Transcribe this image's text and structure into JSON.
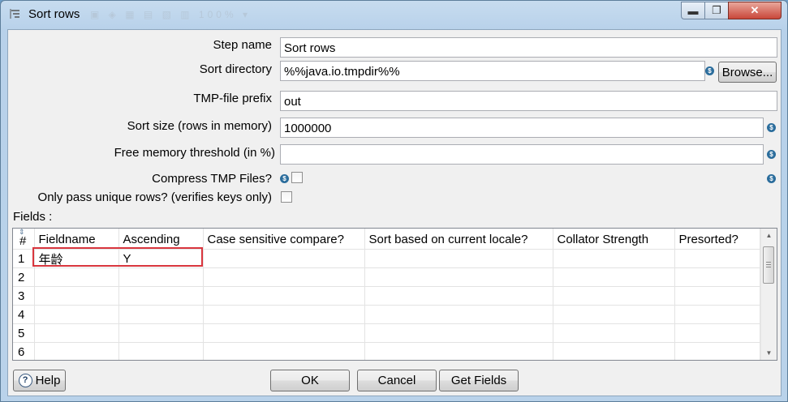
{
  "window": {
    "title": "Sort rows",
    "ghost_toolbar": "▣ ◈ ▦ ▤ ▧ ▥  100%  ▾",
    "controls": {
      "minimize": "▬",
      "maximize": "❐",
      "close": "✕"
    }
  },
  "form": {
    "step_name": {
      "label": "Step name",
      "value": "Sort rows"
    },
    "sort_directory": {
      "label": "Sort directory",
      "value": "%%java.io.tmpdir%%",
      "browse_label": "Browse..."
    },
    "tmp_prefix": {
      "label": "TMP-file prefix",
      "value": "out"
    },
    "sort_size": {
      "label": "Sort size (rows in memory)",
      "value": "1000000"
    },
    "free_memory": {
      "label": "Free memory threshold (in %)",
      "value": ""
    },
    "compress": {
      "label": "Compress TMP Files?",
      "checked": false
    },
    "unique_rows": {
      "label": "Only pass unique rows? (verifies keys only)",
      "checked": false
    },
    "variable_icon": "$"
  },
  "fields_table": {
    "label": "Fields :",
    "sort_icon": "⇕",
    "headers": [
      "#",
      "Fieldname",
      "Ascending",
      "Case sensitive compare?",
      "Sort based on current locale?",
      "Collator Strength",
      "Presorted?"
    ],
    "rows": [
      [
        "1",
        "年龄",
        "Y",
        "",
        "",
        "",
        ""
      ],
      [
        "2",
        "",
        "",
        "",
        "",
        "",
        ""
      ],
      [
        "3",
        "",
        "",
        "",
        "",
        "",
        ""
      ],
      [
        "4",
        "",
        "",
        "",
        "",
        "",
        ""
      ],
      [
        "5",
        "",
        "",
        "",
        "",
        "",
        ""
      ],
      [
        "6",
        "",
        "",
        "",
        "",
        "",
        ""
      ]
    ]
  },
  "buttons": {
    "help": "Help",
    "help_icon": "?",
    "ok": "OK",
    "cancel": "Cancel",
    "get_fields": "Get Fields"
  },
  "colors": {
    "highlight_border": "#d9363e",
    "variable_icon": "#2b6d9c",
    "window_frame": "#b9d2ea"
  }
}
